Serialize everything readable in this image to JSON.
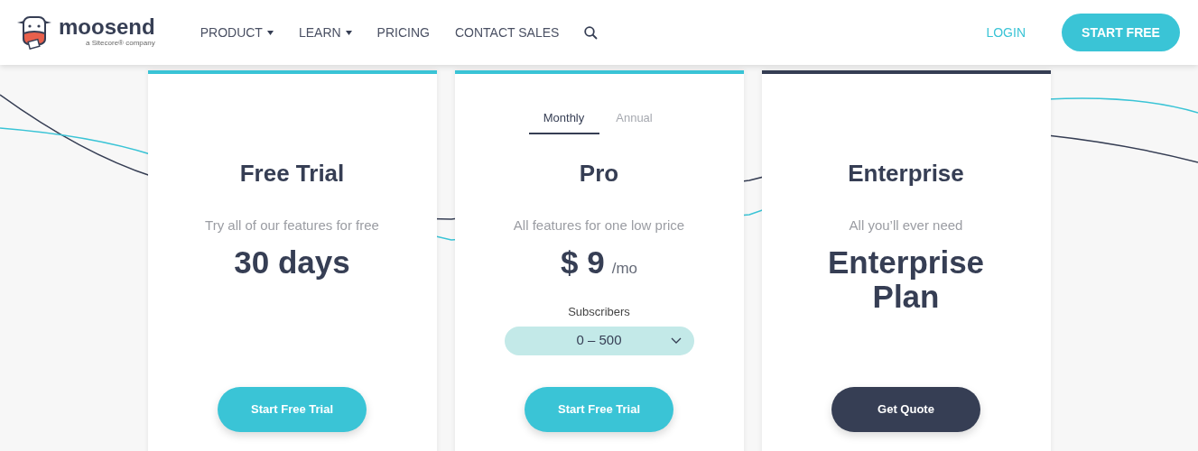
{
  "header": {
    "brand": "moosend",
    "brand_tagline": "a Sitecore® company",
    "nav": [
      {
        "label": "PRODUCT",
        "dropdown": true
      },
      {
        "label": "LEARN",
        "dropdown": true
      },
      {
        "label": "PRICING",
        "dropdown": false
      },
      {
        "label": "CONTACT SALES",
        "dropdown": false
      }
    ],
    "login": "LOGIN",
    "cta": "START FREE"
  },
  "plans": [
    {
      "name": "Free Trial",
      "color": "#3ac4d6",
      "description": "Try all of our features for free",
      "price": "30 days",
      "button": "Start Free Trial"
    },
    {
      "name": "Pro",
      "color": "#3ac4d6",
      "tabs": [
        {
          "label": "Monthly",
          "selected": true
        },
        {
          "label": "Annual",
          "selected": false
        }
      ],
      "description": "All features for one low price",
      "price": "$ 9",
      "price_unit": "/mo",
      "subscribers_label": "Subscribers",
      "subscribers_value": "0 – 500",
      "button": "Start Free Trial"
    },
    {
      "name": "Enterprise",
      "color": "#363e54",
      "description": "All you’ll ever need",
      "price": "Enterprise Plan",
      "button": "Get Quote"
    }
  ]
}
